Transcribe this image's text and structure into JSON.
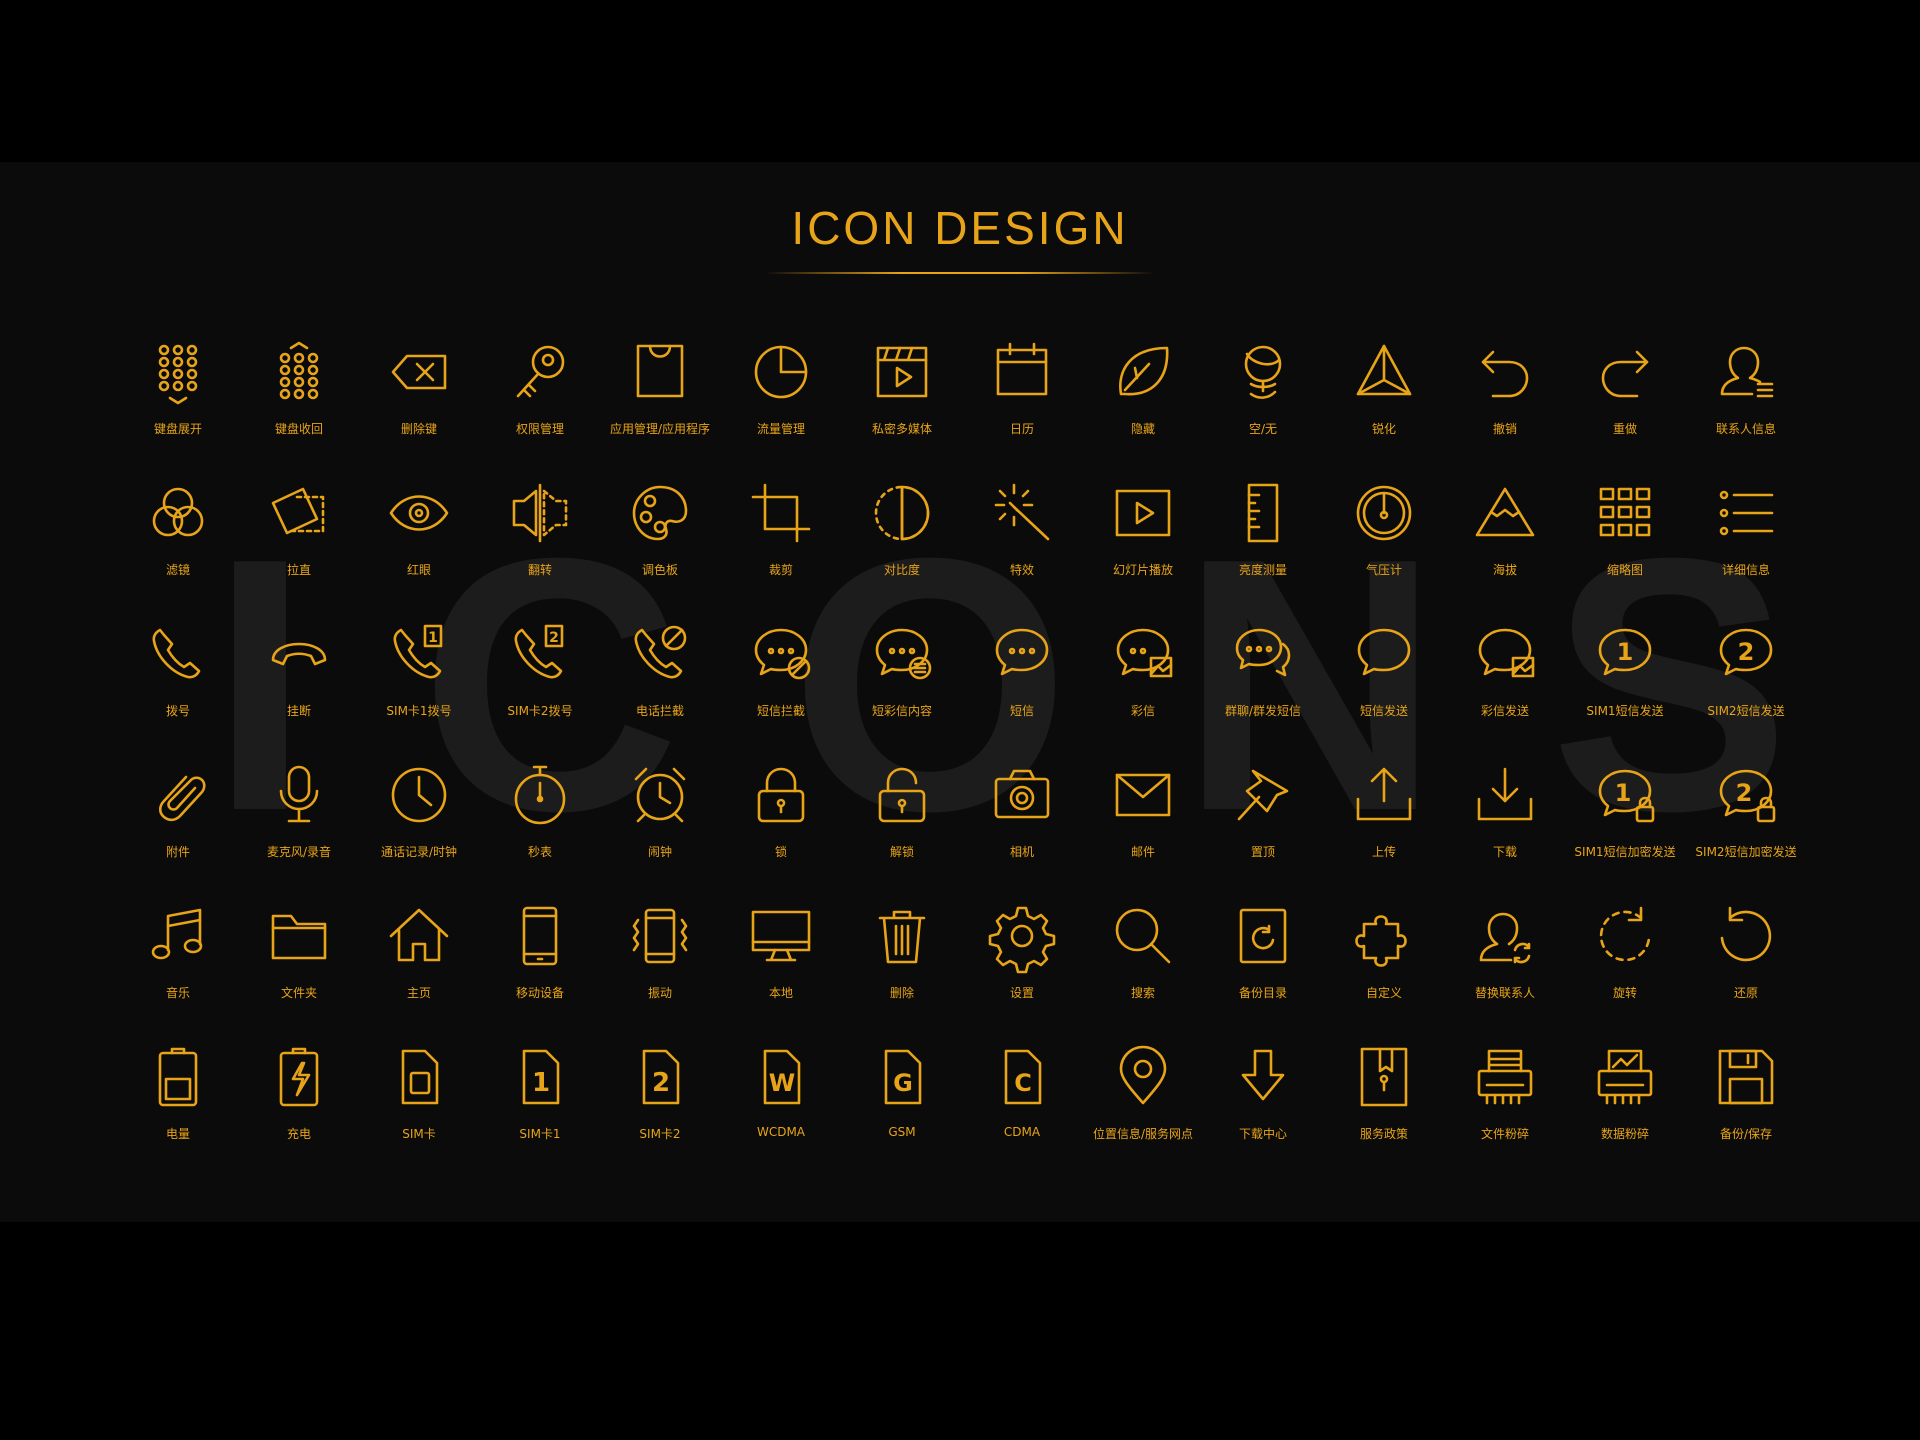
{
  "header": {
    "title": "ICON DESIGN",
    "watermark": "ICONS"
  },
  "accent_color": "#e8a418",
  "rows": [
    [
      {
        "label": "键盘展开",
        "icon": "keyboard-expand-icon"
      },
      {
        "label": "键盘收回",
        "icon": "keyboard-collapse-icon"
      },
      {
        "label": "删除键",
        "icon": "backspace-icon"
      },
      {
        "label": "权限管理",
        "icon": "key-icon"
      },
      {
        "label": "应用管理/应用程序",
        "icon": "shopping-bag-icon"
      },
      {
        "label": "流量管理",
        "icon": "pie-chart-icon"
      },
      {
        "label": "私密多媒体",
        "icon": "clapperboard-icon"
      },
      {
        "label": "日历",
        "icon": "calendar-icon"
      },
      {
        "label": "隐藏",
        "icon": "leaf-icon"
      },
      {
        "label": "空/无",
        "icon": "globe-stand-icon"
      },
      {
        "label": "锐化",
        "icon": "pyramid-icon"
      },
      {
        "label": "撤销",
        "icon": "undo-icon"
      },
      {
        "label": "重做",
        "icon": "redo-icon"
      },
      {
        "label": "联系人信息",
        "icon": "contact-info-icon"
      }
    ],
    [
      {
        "label": "滤镜",
        "icon": "filter-circles-icon"
      },
      {
        "label": "拉直",
        "icon": "straighten-icon"
      },
      {
        "label": "红眼",
        "icon": "eye-icon"
      },
      {
        "label": "翻转",
        "icon": "flip-icon"
      },
      {
        "label": "调色板",
        "icon": "palette-icon"
      },
      {
        "label": "裁剪",
        "icon": "crop-icon"
      },
      {
        "label": "对比度",
        "icon": "contrast-icon"
      },
      {
        "label": "特效",
        "icon": "magic-wand-icon"
      },
      {
        "label": "幻灯片播放",
        "icon": "slideshow-play-icon"
      },
      {
        "label": "亮度测量",
        "icon": "ruler-icon"
      },
      {
        "label": "气压计",
        "icon": "barometer-icon"
      },
      {
        "label": "海拔",
        "icon": "mountain-icon"
      },
      {
        "label": "缩略图",
        "icon": "thumbnails-grid-icon"
      },
      {
        "label": "详细信息",
        "icon": "details-list-icon"
      }
    ],
    [
      {
        "label": "拨号",
        "icon": "phone-icon"
      },
      {
        "label": "挂断",
        "icon": "hang-up-icon"
      },
      {
        "label": "SIM卡1拨号",
        "icon": "phone-sim1-icon",
        "badge": "1"
      },
      {
        "label": "SIM卡2拨号",
        "icon": "phone-sim2-icon",
        "badge": "2"
      },
      {
        "label": "电话拦截",
        "icon": "phone-block-icon"
      },
      {
        "label": "短信拦截",
        "icon": "message-block-icon"
      },
      {
        "label": "短彩信内容",
        "icon": "message-content-icon"
      },
      {
        "label": "短信",
        "icon": "message-icon"
      },
      {
        "label": "彩信",
        "icon": "mms-icon"
      },
      {
        "label": "群聊/群发短信",
        "icon": "group-message-icon"
      },
      {
        "label": "短信发送",
        "icon": "message-send-icon"
      },
      {
        "label": "彩信发送",
        "icon": "mms-send-icon"
      },
      {
        "label": "SIM1短信发送",
        "icon": "sim1-message-icon",
        "badge": "1"
      },
      {
        "label": "SIM2短信发送",
        "icon": "sim2-message-icon",
        "badge": "2"
      }
    ],
    [
      {
        "label": "附件",
        "icon": "paperclip-icon"
      },
      {
        "label": "麦克风/录音",
        "icon": "microphone-icon"
      },
      {
        "label": "通话记录/时钟",
        "icon": "clock-icon"
      },
      {
        "label": "秒表",
        "icon": "stopwatch-icon"
      },
      {
        "label": "闹钟",
        "icon": "alarm-clock-icon"
      },
      {
        "label": "锁",
        "icon": "lock-icon"
      },
      {
        "label": "解锁",
        "icon": "unlock-icon"
      },
      {
        "label": "相机",
        "icon": "camera-icon"
      },
      {
        "label": "邮件",
        "icon": "mail-icon"
      },
      {
        "label": "置顶",
        "icon": "pin-icon"
      },
      {
        "label": "上传",
        "icon": "upload-icon"
      },
      {
        "label": "下载",
        "icon": "download-icon"
      },
      {
        "label": "SIM1短信加密发送",
        "icon": "sim1-encrypted-message-icon",
        "badge": "1"
      },
      {
        "label": "SIM2短信加密发送",
        "icon": "sim2-encrypted-message-icon",
        "badge": "2"
      }
    ],
    [
      {
        "label": "音乐",
        "icon": "music-note-icon"
      },
      {
        "label": "文件夹",
        "icon": "folder-icon"
      },
      {
        "label": "主页",
        "icon": "home-icon"
      },
      {
        "label": "移动设备",
        "icon": "mobile-device-icon"
      },
      {
        "label": "振动",
        "icon": "vibrate-icon"
      },
      {
        "label": "本地",
        "icon": "monitor-icon"
      },
      {
        "label": "删除",
        "icon": "trash-icon"
      },
      {
        "label": "设置",
        "icon": "gear-icon"
      },
      {
        "label": "搜索",
        "icon": "search-icon"
      },
      {
        "label": "备份目录",
        "icon": "backup-directory-icon"
      },
      {
        "label": "自定义",
        "icon": "puzzle-icon"
      },
      {
        "label": "替换联系人",
        "icon": "replace-contact-icon"
      },
      {
        "label": "旋转",
        "icon": "rotate-icon"
      },
      {
        "label": "还原",
        "icon": "restore-icon"
      }
    ],
    [
      {
        "label": "电量",
        "icon": "battery-icon"
      },
      {
        "label": "充电",
        "icon": "charging-icon"
      },
      {
        "label": "SIM卡",
        "icon": "sim-card-icon"
      },
      {
        "label": "SIM卡1",
        "icon": "sim-card-1-icon",
        "badge": "1"
      },
      {
        "label": "SIM卡2",
        "icon": "sim-card-2-icon",
        "badge": "2"
      },
      {
        "label": "WCDMA",
        "icon": "wcdma-card-icon",
        "badge": "W"
      },
      {
        "label": "GSM",
        "icon": "gsm-card-icon",
        "badge": "G"
      },
      {
        "label": "CDMA",
        "icon": "cdma-card-icon",
        "badge": "C"
      },
      {
        "label": "位置信息/服务网点",
        "icon": "location-pin-icon"
      },
      {
        "label": "下载中心",
        "icon": "download-center-icon"
      },
      {
        "label": "服务政策",
        "icon": "service-policy-icon"
      },
      {
        "label": "文件粉碎",
        "icon": "file-shredder-icon"
      },
      {
        "label": "数据粉碎",
        "icon": "data-shredder-icon"
      },
      {
        "label": "备份/保存",
        "icon": "save-floppy-icon"
      }
    ]
  ]
}
